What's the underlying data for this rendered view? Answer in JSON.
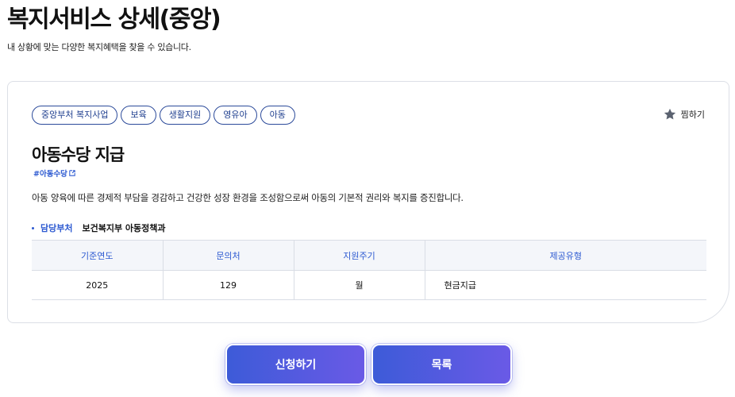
{
  "page": {
    "title": "복지서비스 상세(중앙)",
    "subtitle": "내 상황에 맞는 다양한 복지혜택을 찾을 수 있습니다."
  },
  "card": {
    "tags": [
      "중앙부처 복지사업",
      "보육",
      "생활지원",
      "영유아",
      "아동"
    ],
    "bookmark_label": "찜하기",
    "bookmark_icon": "star-icon",
    "service_title": "아동수당 지급",
    "hashtag": "#아동수당",
    "hashtag_icon": "external-link-icon",
    "description": "아동 양육에 따른 경제적 부담을 경감하고 건강한 성장 환경을 조성함으로써 아동의 기본적 권리와 복지를 증진합니다.",
    "department": {
      "label": "담당부처",
      "value": "보건복지부 아동정책과"
    },
    "table": {
      "headers": [
        "기준연도",
        "문의처",
        "지원주기",
        "제공유형"
      ],
      "row": [
        "2025",
        "129",
        "월",
        "현금지급"
      ]
    }
  },
  "buttons": {
    "apply": "신청하기",
    "list": "목록"
  },
  "colors": {
    "accent": "#2d5ad1",
    "button_gradient_start": "#3d5bd8",
    "button_gradient_end": "#6a5ae6"
  }
}
